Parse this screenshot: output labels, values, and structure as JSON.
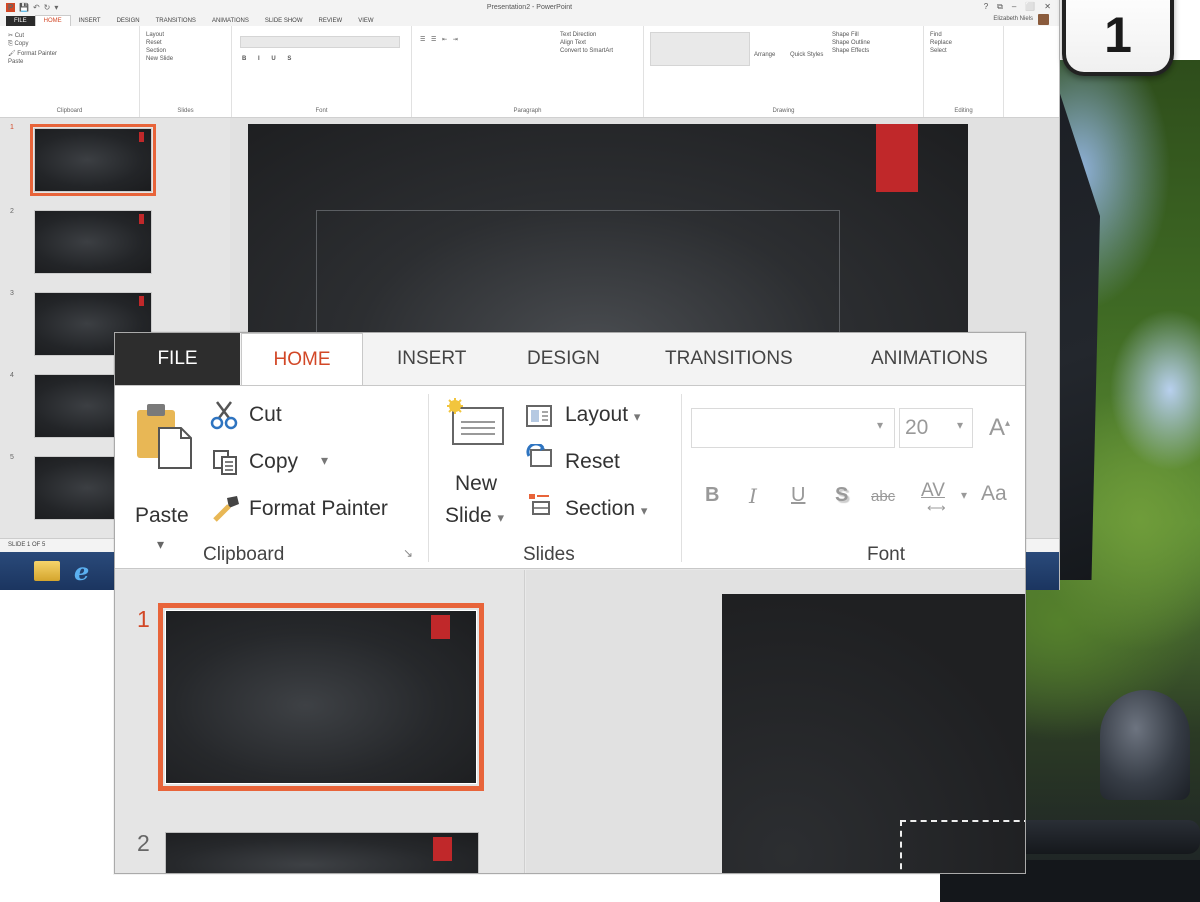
{
  "step_number": "1",
  "colors": {
    "accent": "#d24726",
    "selection": "#e8643a",
    "slide_marker": "#c0282a",
    "file_tab": "#2d2d2d"
  },
  "mini_window": {
    "title": "Presentation2 - PowerPoint",
    "tabs": [
      "FILE",
      "HOME",
      "INSERT",
      "DESIGN",
      "TRANSITIONS",
      "ANIMATIONS",
      "SLIDE SHOW",
      "REVIEW",
      "VIEW"
    ],
    "user_name": "Elizabeth Niels",
    "window_buttons": [
      "?",
      "⧉",
      "–",
      "⬜",
      "✕"
    ],
    "ribbon": {
      "clipboard": {
        "label": "Clipboard",
        "paste": "Paste",
        "cut": "Cut",
        "copy": "Copy",
        "format_painter": "Format Painter"
      },
      "slides": {
        "label": "Slides",
        "new_slide_line1": "New",
        "new_slide_line2": "Slide",
        "layout": "Layout",
        "reset": "Reset",
        "section": "Section"
      },
      "font": {
        "label": "Font"
      },
      "paragraph": {
        "label": "Paragraph",
        "text_direction": "Text Direction",
        "align_text": "Align Text",
        "convert_smartart": "Convert to SmartArt"
      },
      "drawing": {
        "label": "Drawing",
        "arrange": "Arrange",
        "quick_styles": "Quick Styles",
        "shape_fill": "Shape Fill",
        "shape_outline": "Shape Outline",
        "shape_effects": "Shape Effects"
      },
      "editing": {
        "label": "Editing",
        "find": "Find",
        "replace": "Replace",
        "select": "Select"
      }
    },
    "slide_numbers": [
      "1",
      "2",
      "3",
      "4",
      "5"
    ],
    "status_text": "SLIDE 1 OF 5"
  },
  "zoom": {
    "tabs": {
      "file": "FILE",
      "home": "HOME",
      "insert": "INSERT",
      "design": "DESIGN",
      "transitions": "TRANSITIONS",
      "animations": "ANIMATIONS"
    },
    "clipboard": {
      "label": "Clipboard",
      "paste": "Paste",
      "cut": "Cut",
      "copy": "Copy",
      "format_painter": "Format Painter"
    },
    "slides": {
      "label": "Slides",
      "new_line1": "New",
      "new_line2": "Slide",
      "layout": "Layout",
      "reset": "Reset",
      "section": "Section"
    },
    "font": {
      "label": "Font",
      "size": "20",
      "grow_glyph": "A",
      "case_glyph": "Aa",
      "bold": "B",
      "italic": "I",
      "underline": "U",
      "shadow": "S",
      "strike": "abc",
      "spacing": "AV"
    },
    "slide_numbers": [
      "1",
      "2"
    ]
  }
}
